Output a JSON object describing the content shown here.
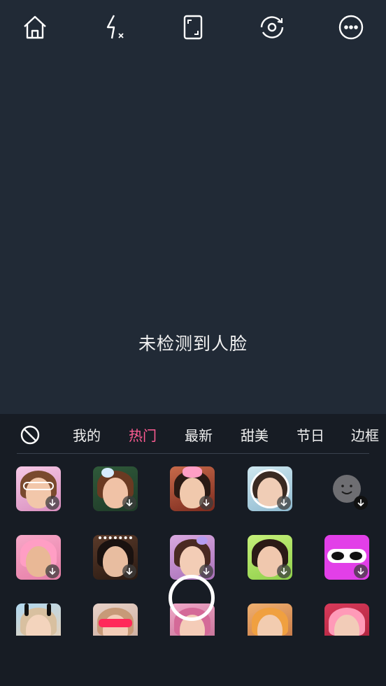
{
  "top_bar": {
    "buttons": [
      {
        "name": "home-button",
        "icon": "home-icon"
      },
      {
        "name": "flash-button",
        "icon": "flash-off-icon"
      },
      {
        "name": "aspect-ratio-button",
        "icon": "aspect-ratio-icon"
      },
      {
        "name": "switch-camera-button",
        "icon": "camera-switch-icon"
      },
      {
        "name": "more-button",
        "icon": "more-icon"
      }
    ]
  },
  "viewport": {
    "status_text": "未检测到人脸"
  },
  "tabs": {
    "none_icon": "no-effect-icon",
    "items": [
      {
        "label": "我的"
      },
      {
        "label": "热门",
        "active": true
      },
      {
        "label": "最新"
      },
      {
        "label": "甜美"
      },
      {
        "label": "节日"
      },
      {
        "label": "边框"
      }
    ],
    "active_color": "#ff5c93"
  },
  "stickers": {
    "rows": [
      [
        "heart-glasses-sticker",
        "bear-flowers-sticker",
        "pink-bow-sticker",
        "floral-frame-sticker",
        "placeholder-face-sticker"
      ],
      [
        "pink-bear-hat-sticker",
        "dog-ears-sticker",
        "butterfly-sticker",
        "green-portrait-sticker",
        "cow-glasses-sticker"
      ],
      [
        "bunny-ears-sticker",
        "red-glasses-sticker",
        "devil-horns-sticker",
        "cat-hat-sticker",
        "pink-mouse-sticker"
      ]
    ]
  },
  "shutter": {
    "icon": "shutter-button"
  }
}
